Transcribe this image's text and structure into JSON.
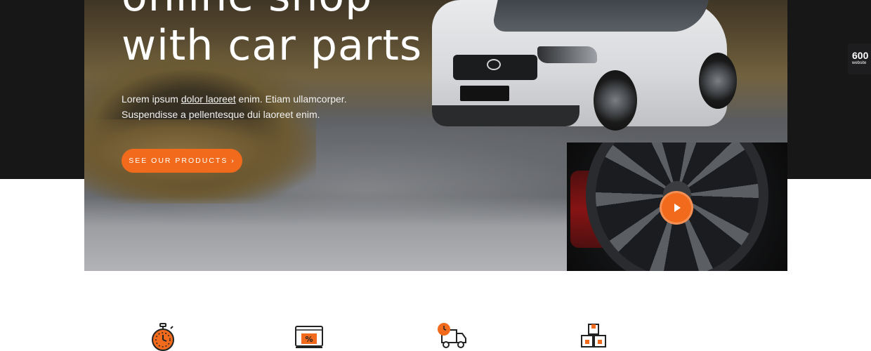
{
  "hero": {
    "title_line1": "online shop",
    "title_line2": "with car parts",
    "desc_pre": "Lorem ipsum ",
    "desc_link": "dolor laoreet",
    "desc_post": " enim. Etiam ullamcorper.",
    "desc_line2": "Suspendisse a pellentesque dui laoreet enim.",
    "cta_label": "SEE OUR PRODUCTS ›"
  },
  "video": {
    "icon": "play-icon"
  },
  "side_badge": {
    "number": "600",
    "label": "website"
  },
  "features": [
    {
      "icon": "stopwatch-icon"
    },
    {
      "icon": "discount-laptop-icon"
    },
    {
      "icon": "delivery-truck-icon"
    },
    {
      "icon": "boxes-icon"
    }
  ],
  "colors": {
    "accent": "#f26b1d",
    "dark": "#171717",
    "background": "#ffffff"
  }
}
